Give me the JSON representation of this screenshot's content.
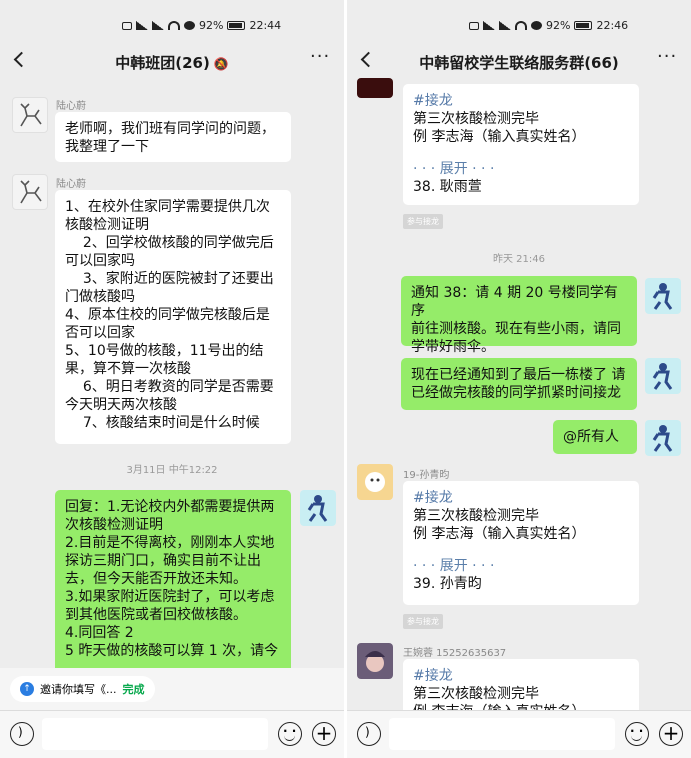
{
  "status_left": {
    "battery": "92%",
    "time": "22:44"
  },
  "status_right": {
    "battery": "92%",
    "time": "22:46"
  },
  "left_chat": {
    "title": "中韩班团(26)",
    "messages": [
      {
        "sender": "陆心蔚",
        "text": "老师啊，我们班有同学问的问题，\n我整理了一下"
      },
      {
        "sender": "陆心蔚",
        "text": "1、在校外住家同学需要提供几次\n核酸检测证明\n    2、回学校做核酸的同学做完后\n可以回家吗\n    3、家附近的医院被封了还要出\n门做核酸吗\n4、原本住校的同学做完核酸后是\n否可以回家\n5、10号做的核酸，11号出的结\n果，算不算一次核酸\n    6、明日考教资的同学是否需要\n今天明天两次核酸\n    7、核酸结束时间是什么时候"
      }
    ],
    "time_label": "3月11日 中午12:22",
    "reply": "回复：1.无论校内外都需要提供两\n次核酸检测证明\n2.目前是不得离校，刚刚本人实地\n探访三期门口，确实目前不让出\n去，但今天能否开放还未知。\n3.如果家附近医院封了，可以考虑\n到其他医院或者回校做核酸。\n4.同回答 2\n5 昨天做的核酸可以算 1 次，请今",
    "notice": {
      "text": "邀请你填写《...",
      "done": "完成"
    }
  },
  "right_chat": {
    "title": "中韩留校学生联络服务群(66)",
    "card1": {
      "tag": "#接龙",
      "line1": "第三次核酸检测完毕",
      "line2": "例 李志海（输入真实姓名）",
      "expand": "· · · 展开 · · ·",
      "entry": "38. 耿雨萱"
    },
    "chip": "参与接龙",
    "time_label": "昨天 21:46",
    "green1": "通知 38：请 4 期 20 号楼同学有序\n前往测核酸。现在有些小雨，请同\n学带好雨伞。",
    "green2": "现在已经通知到了最后一栋楼了 请\n已经做完核酸的同学抓紧时间接龙",
    "green3": "@所有人",
    "sender2": "19-孙青昀",
    "card2": {
      "tag": "#接龙",
      "line1": "第三次核酸检测完毕",
      "line2": "例 李志海（输入真实姓名）",
      "expand": "· · · 展开 · · ·",
      "entry": "39. 孙青昀"
    },
    "sender3": "王婉蓉 15252635637",
    "card3": {
      "tag": "#接龙",
      "line1": "第三次核酸检测完毕",
      "line2": "例 李志海（输入真实姓名）"
    }
  }
}
